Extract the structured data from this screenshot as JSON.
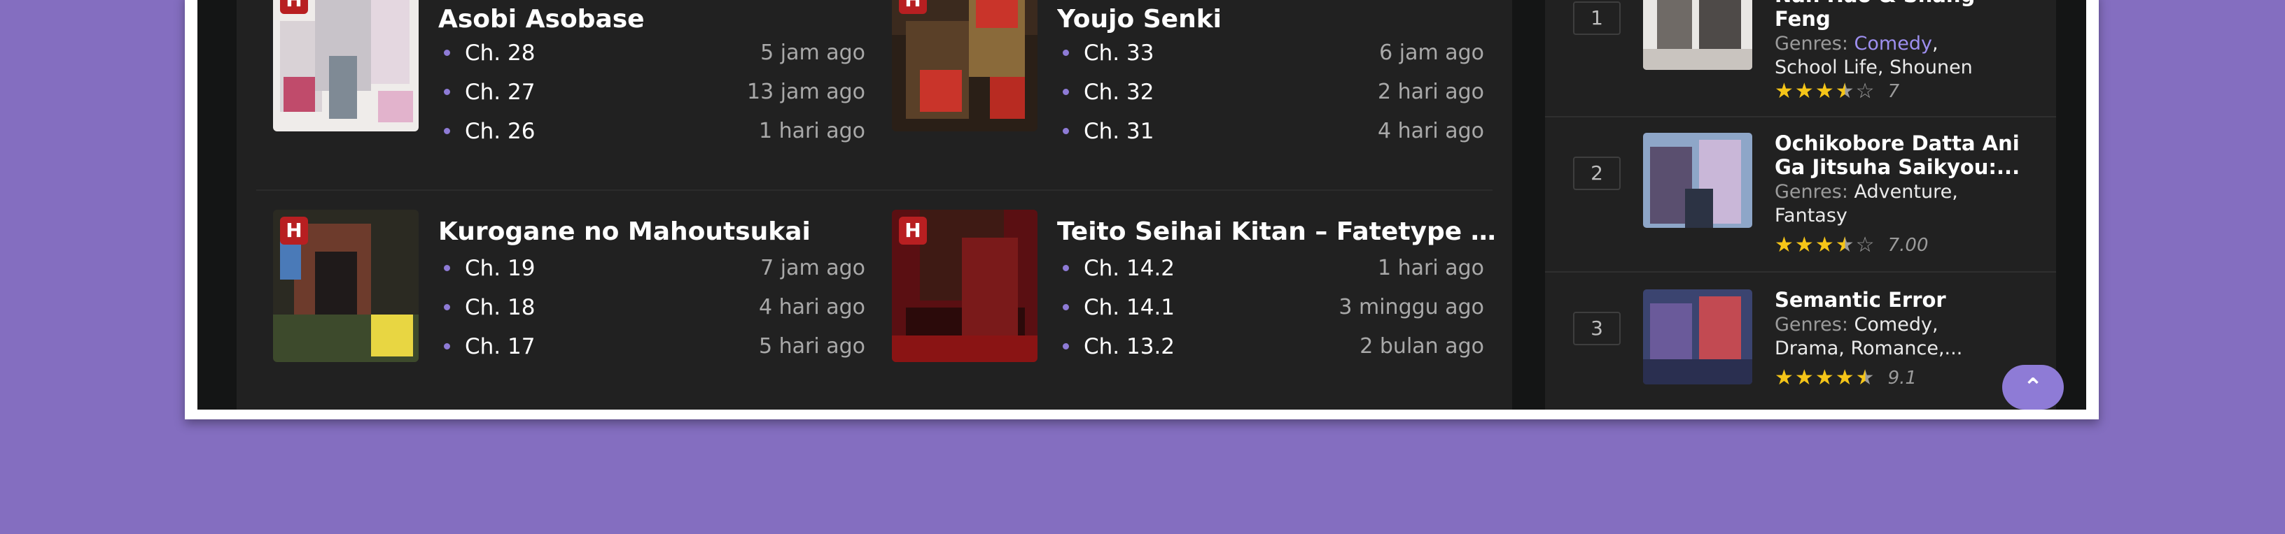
{
  "badge_letter": "H",
  "manga": [
    {
      "title": "Asobi Asobase",
      "chapters": [
        {
          "name": "Ch. 28",
          "time": "5 jam ago"
        },
        {
          "name": "Ch. 27",
          "time": "13 jam ago"
        },
        {
          "name": "Ch. 26",
          "time": "1 hari ago"
        }
      ]
    },
    {
      "title": "Youjo Senki",
      "chapters": [
        {
          "name": "Ch. 33",
          "time": "6 jam ago"
        },
        {
          "name": "Ch. 32",
          "time": "2 hari ago"
        },
        {
          "name": "Ch. 31",
          "time": "4 hari ago"
        }
      ]
    },
    {
      "title": "Kurogane no Mahoutsukai",
      "chapters": [
        {
          "name": "Ch. 19",
          "time": "7 jam ago"
        },
        {
          "name": "Ch. 18",
          "time": "4 hari ago"
        },
        {
          "name": "Ch. 17",
          "time": "5 hari ago"
        }
      ]
    },
    {
      "title": "Teito Seihai Kitan – Fatetype Red...",
      "chapters": [
        {
          "name": "Ch. 14.2",
          "time": "1 hari ago"
        },
        {
          "name": "Ch. 14.1",
          "time": "3 minggu ago"
        },
        {
          "name": "Ch. 13.2",
          "time": "2 bulan ago"
        }
      ]
    }
  ],
  "popular": [
    {
      "rank": "1",
      "title_line1": "Nan Hao & Shang",
      "title_line2": "Feng",
      "genres_label": "Genres:",
      "genres": [
        "Comedy",
        "School Life",
        "Shounen"
      ],
      "rating": 7,
      "score": "7"
    },
    {
      "rank": "2",
      "title_line1": "Ochikobore Datta Ani",
      "title_line2": "Ga Jitsuha Saikyou:...",
      "genres_label": "Genres:",
      "genres": [
        "Adventure",
        "Fantasy"
      ],
      "rating": 7,
      "score": "7.00"
    },
    {
      "rank": "3",
      "title_line1": "Semantic Error",
      "title_line2": "",
      "genres_label": "Genres:",
      "genres": [
        "Comedy",
        "Drama",
        "Romance,..."
      ],
      "rating": 9.1,
      "score": "9.1"
    }
  ],
  "colors": {
    "page_bg": "#846ec0",
    "accent": "#8e7bd6",
    "badge": "#b81f21",
    "star": "#f5c518"
  },
  "icons": {
    "scroll_top": "chevron-up-icon",
    "star": "star-icon"
  }
}
